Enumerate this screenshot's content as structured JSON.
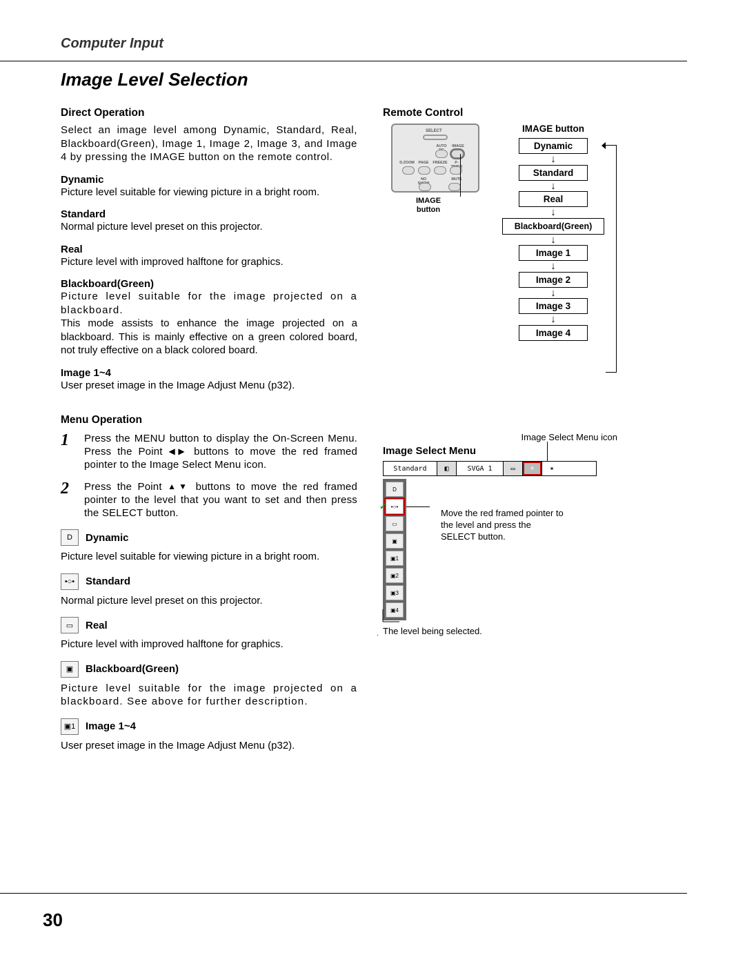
{
  "header": "Computer Input",
  "title": "Image Level Selection",
  "direct": {
    "heading": "Direct Operation",
    "intro": "Select an image level among Dynamic, Standard, Real, Blackboard(Green), Image 1, Image 2, Image 3, and Image 4 by pressing the IMAGE button on the remote control.",
    "dynamic_h": "Dynamic",
    "dynamic_d": "Picture level suitable for viewing picture in a bright room.",
    "standard_h": "Standard",
    "standard_d": "Normal picture level preset on this projector.",
    "real_h": "Real",
    "real_d": "Picture level with improved halftone for graphics.",
    "bb_h": "Blackboard(Green)",
    "bb_d1": "Picture level suitable for the image projected on a blackboard.",
    "bb_d2": "This mode assists to enhance the image projected on a blackboard.  This is mainly effective on a green colored board, not truly effective on a black colored board.",
    "img14_h": "Image 1~4",
    "img14_d": "User preset image in the Image Adjust Menu (p32)."
  },
  "menu": {
    "heading": "Menu Operation",
    "step1_pre": "Press the MENU button to display the On-Screen Menu.  Press the Point ",
    "step1_post": " buttons to move the red framed pointer to the Image Select Menu icon.",
    "step2_pre": "Press the Point ",
    "step2_post": " buttons to move the red framed pointer to the level that you want to set and then press the SELECT button.",
    "modes": {
      "dyn_h": "Dynamic",
      "dyn_d": "Picture level suitable for viewing picture in a bright room.",
      "std_h": "Standard",
      "std_d": "Normal picture level preset on this projector.",
      "real_h": "Real",
      "real_d": "Picture level with improved halftone for graphics.",
      "bb_h": "Blackboard(Green)",
      "bb_d": "Picture level suitable for the image projected on a blackboard.   See above for further description.",
      "i14_h": "Image 1~4",
      "i14_d": "User preset image in the Image Adjust Menu (p32)."
    }
  },
  "remote": {
    "heading": "Remote Control",
    "image_btn_caption": "IMAGE button",
    "buttons": {
      "select": "SELECT",
      "autopc": "AUTO PC",
      "image": "IMAGE",
      "dzoom": "D.ZOOM",
      "page": "PAGE",
      "freeze": "FREEZE",
      "ptimer": "P-TIMER",
      "noshow": "NO SHOW",
      "mute": "MUTE"
    }
  },
  "flow": {
    "title": "IMAGE button",
    "items": [
      "Dynamic",
      "Standard",
      "Real",
      "Blackboard(Green)",
      "Image 1",
      "Image 2",
      "Image 3",
      "Image 4"
    ]
  },
  "ism": {
    "icon_label": "Image Select Menu icon",
    "title": "Image Select Menu",
    "bar_standard": "Standard",
    "bar_svga": "SVGA 1",
    "note": "Move the red framed pointer to the level and press the SELECT button.",
    "caption_below": "The level being selected.",
    "items_lbl": [
      "D",
      "•○•",
      "▭",
      "▣",
      "▣1",
      "▣2",
      "▣3",
      "▣4"
    ]
  },
  "page_number": "30",
  "icons": {
    "dyn": "D",
    "std": "•○•",
    "real": "▭",
    "bb": "▣",
    "i1": "▣1"
  }
}
